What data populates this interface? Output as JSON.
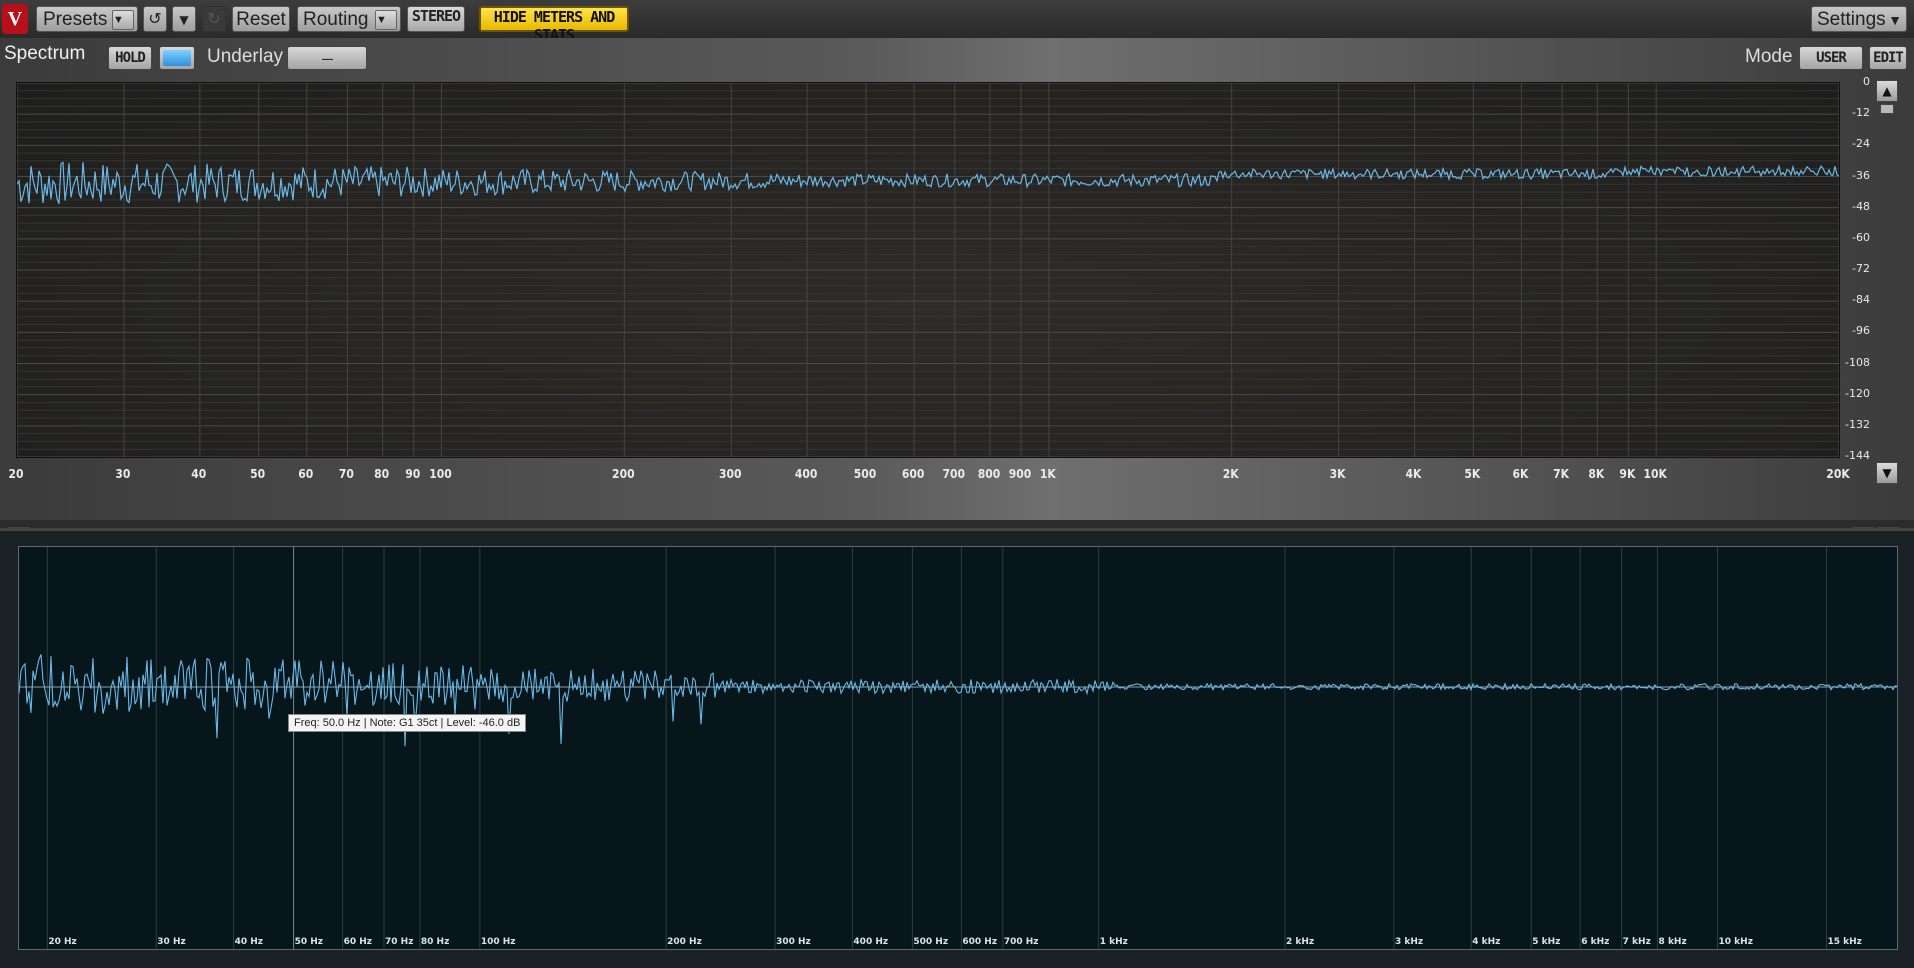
{
  "toolbar": {
    "logo": "V",
    "presets": "Presets",
    "reset": "Reset",
    "routing": "Routing",
    "stereo": "STEREO",
    "hide_meters": "HIDE METERS AND STATS",
    "settings": "Settings"
  },
  "spectrum": {
    "title": "Spectrum",
    "hold": "HOLD",
    "underlay_label": "Underlay",
    "underlay_value": "---",
    "mode_label": "Mode",
    "mode_user": "USER",
    "mode_edit": "EDIT",
    "y_labels": [
      "0",
      "-12",
      "-24",
      "-36",
      "-48",
      "-60",
      "-72",
      "-84",
      "-96",
      "-108",
      "-120",
      "-132",
      "-144"
    ],
    "x_labels": [
      "20",
      "30",
      "40",
      "50",
      "60",
      "70",
      "80",
      "90",
      "100",
      "200",
      "300",
      "400",
      "500",
      "600",
      "700",
      "800",
      "900",
      "1K",
      "2K",
      "3K",
      "4K",
      "5K",
      "6K",
      "7K",
      "8K",
      "9K",
      "10K",
      "20K"
    ],
    "x_freqs": [
      20,
      30,
      40,
      50,
      60,
      70,
      80,
      90,
      100,
      200,
      300,
      400,
      500,
      600,
      700,
      800,
      900,
      1000,
      2000,
      3000,
      4000,
      5000,
      6000,
      7000,
      8000,
      9000,
      10000,
      20000
    ]
  },
  "analyzer2": {
    "x_labels": [
      "20 Hz",
      "30 Hz",
      "40 Hz",
      "50 Hz",
      "60 Hz",
      "70 Hz",
      "80 Hz",
      "100 Hz",
      "200 Hz",
      "300 Hz",
      "400 Hz",
      "500 Hz",
      "600 Hz",
      "700 Hz",
      "1 kHz",
      "2 kHz",
      "3 kHz",
      "4 kHz",
      "5 kHz",
      "6 kHz",
      "7 kHz",
      "8 kHz",
      "10 kHz",
      "15 kHz"
    ],
    "x_freqs": [
      20,
      30,
      40,
      50,
      60,
      70,
      80,
      100,
      200,
      300,
      400,
      500,
      600,
      700,
      1000,
      2000,
      3000,
      4000,
      5000,
      6000,
      7000,
      8000,
      10000,
      15000
    ],
    "tooltip": "Freq: 50.0 Hz | Note: G1 35ct | Level: -46.0 dB"
  },
  "colors": {
    "accent": "#6ab8e8",
    "highlight": "#ffd92e"
  }
}
